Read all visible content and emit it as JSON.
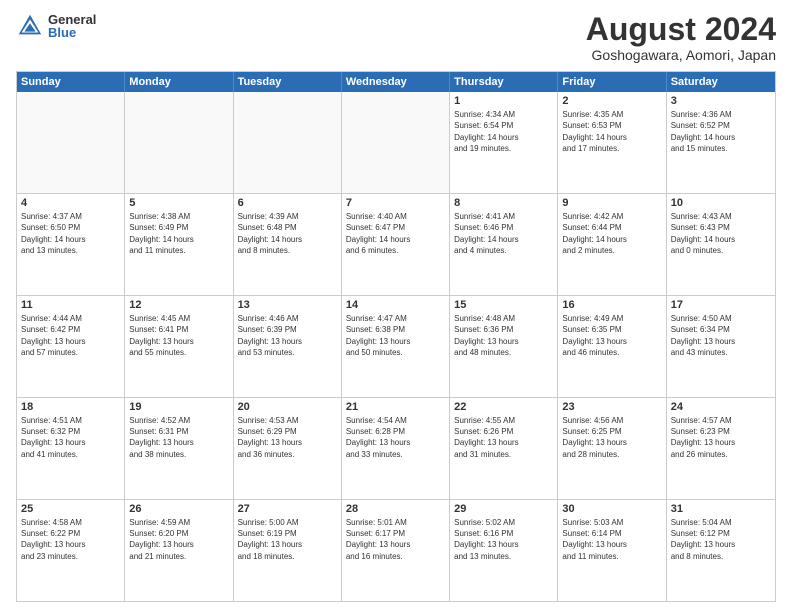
{
  "logo": {
    "general": "General",
    "blue": "Blue"
  },
  "title": "August 2024",
  "location": "Goshogawara, Aomori, Japan",
  "headers": [
    "Sunday",
    "Monday",
    "Tuesday",
    "Wednesday",
    "Thursday",
    "Friday",
    "Saturday"
  ],
  "weeks": [
    [
      {
        "day": "",
        "info": ""
      },
      {
        "day": "",
        "info": ""
      },
      {
        "day": "",
        "info": ""
      },
      {
        "day": "",
        "info": ""
      },
      {
        "day": "1",
        "info": "Sunrise: 4:34 AM\nSunset: 6:54 PM\nDaylight: 14 hours\nand 19 minutes."
      },
      {
        "day": "2",
        "info": "Sunrise: 4:35 AM\nSunset: 6:53 PM\nDaylight: 14 hours\nand 17 minutes."
      },
      {
        "day": "3",
        "info": "Sunrise: 4:36 AM\nSunset: 6:52 PM\nDaylight: 14 hours\nand 15 minutes."
      }
    ],
    [
      {
        "day": "4",
        "info": "Sunrise: 4:37 AM\nSunset: 6:50 PM\nDaylight: 14 hours\nand 13 minutes."
      },
      {
        "day": "5",
        "info": "Sunrise: 4:38 AM\nSunset: 6:49 PM\nDaylight: 14 hours\nand 11 minutes."
      },
      {
        "day": "6",
        "info": "Sunrise: 4:39 AM\nSunset: 6:48 PM\nDaylight: 14 hours\nand 8 minutes."
      },
      {
        "day": "7",
        "info": "Sunrise: 4:40 AM\nSunset: 6:47 PM\nDaylight: 14 hours\nand 6 minutes."
      },
      {
        "day": "8",
        "info": "Sunrise: 4:41 AM\nSunset: 6:46 PM\nDaylight: 14 hours\nand 4 minutes."
      },
      {
        "day": "9",
        "info": "Sunrise: 4:42 AM\nSunset: 6:44 PM\nDaylight: 14 hours\nand 2 minutes."
      },
      {
        "day": "10",
        "info": "Sunrise: 4:43 AM\nSunset: 6:43 PM\nDaylight: 14 hours\nand 0 minutes."
      }
    ],
    [
      {
        "day": "11",
        "info": "Sunrise: 4:44 AM\nSunset: 6:42 PM\nDaylight: 13 hours\nand 57 minutes."
      },
      {
        "day": "12",
        "info": "Sunrise: 4:45 AM\nSunset: 6:41 PM\nDaylight: 13 hours\nand 55 minutes."
      },
      {
        "day": "13",
        "info": "Sunrise: 4:46 AM\nSunset: 6:39 PM\nDaylight: 13 hours\nand 53 minutes."
      },
      {
        "day": "14",
        "info": "Sunrise: 4:47 AM\nSunset: 6:38 PM\nDaylight: 13 hours\nand 50 minutes."
      },
      {
        "day": "15",
        "info": "Sunrise: 4:48 AM\nSunset: 6:36 PM\nDaylight: 13 hours\nand 48 minutes."
      },
      {
        "day": "16",
        "info": "Sunrise: 4:49 AM\nSunset: 6:35 PM\nDaylight: 13 hours\nand 46 minutes."
      },
      {
        "day": "17",
        "info": "Sunrise: 4:50 AM\nSunset: 6:34 PM\nDaylight: 13 hours\nand 43 minutes."
      }
    ],
    [
      {
        "day": "18",
        "info": "Sunrise: 4:51 AM\nSunset: 6:32 PM\nDaylight: 13 hours\nand 41 minutes."
      },
      {
        "day": "19",
        "info": "Sunrise: 4:52 AM\nSunset: 6:31 PM\nDaylight: 13 hours\nand 38 minutes."
      },
      {
        "day": "20",
        "info": "Sunrise: 4:53 AM\nSunset: 6:29 PM\nDaylight: 13 hours\nand 36 minutes."
      },
      {
        "day": "21",
        "info": "Sunrise: 4:54 AM\nSunset: 6:28 PM\nDaylight: 13 hours\nand 33 minutes."
      },
      {
        "day": "22",
        "info": "Sunrise: 4:55 AM\nSunset: 6:26 PM\nDaylight: 13 hours\nand 31 minutes."
      },
      {
        "day": "23",
        "info": "Sunrise: 4:56 AM\nSunset: 6:25 PM\nDaylight: 13 hours\nand 28 minutes."
      },
      {
        "day": "24",
        "info": "Sunrise: 4:57 AM\nSunset: 6:23 PM\nDaylight: 13 hours\nand 26 minutes."
      }
    ],
    [
      {
        "day": "25",
        "info": "Sunrise: 4:58 AM\nSunset: 6:22 PM\nDaylight: 13 hours\nand 23 minutes."
      },
      {
        "day": "26",
        "info": "Sunrise: 4:59 AM\nSunset: 6:20 PM\nDaylight: 13 hours\nand 21 minutes."
      },
      {
        "day": "27",
        "info": "Sunrise: 5:00 AM\nSunset: 6:19 PM\nDaylight: 13 hours\nand 18 minutes."
      },
      {
        "day": "28",
        "info": "Sunrise: 5:01 AM\nSunset: 6:17 PM\nDaylight: 13 hours\nand 16 minutes."
      },
      {
        "day": "29",
        "info": "Sunrise: 5:02 AM\nSunset: 6:16 PM\nDaylight: 13 hours\nand 13 minutes."
      },
      {
        "day": "30",
        "info": "Sunrise: 5:03 AM\nSunset: 6:14 PM\nDaylight: 13 hours\nand 11 minutes."
      },
      {
        "day": "31",
        "info": "Sunrise: 5:04 AM\nSunset: 6:12 PM\nDaylight: 13 hours\nand 8 minutes."
      }
    ]
  ]
}
